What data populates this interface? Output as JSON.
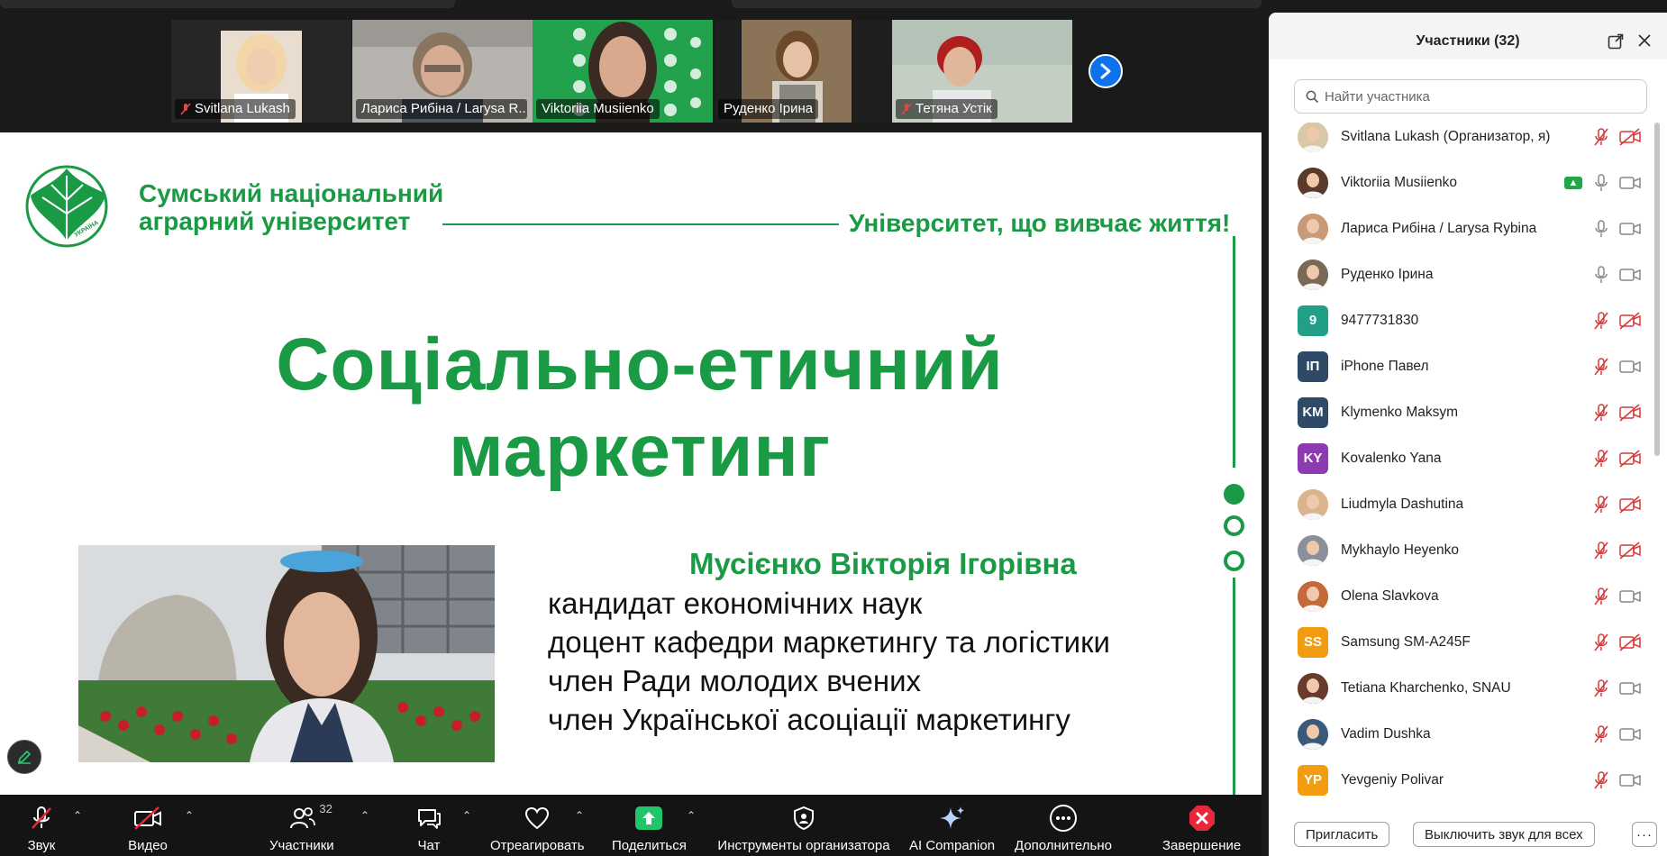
{
  "video_strip": {
    "tiles": [
      {
        "name": "Svitlana Lukash",
        "muted": true
      },
      {
        "name": "Лариса Рибіна / Larysa R...",
        "muted": false
      },
      {
        "name": "Viktoriia Musiienko",
        "muted": false,
        "active": true
      },
      {
        "name": "Руденко Ірина",
        "muted": false
      },
      {
        "name": "Тетяна Устік",
        "muted": true
      }
    ],
    "next_icon": "chevron-right-icon"
  },
  "slide": {
    "university_line1": "Сумський національний",
    "university_line2": "аграрний університет",
    "tagline": "Університет, що вивчає життя!",
    "logo_text": "УКРАЇНА",
    "title_line1": "Соціально-етичний",
    "title_line2": "маркетинг",
    "author": "Мусієнко Вікторія Ігорівна",
    "credentials": [
      "кандидат економічних наук",
      "доцент кафедри маркетингу та логістики",
      "член Ради молодих вчених",
      "член Української асоціації маркетингу"
    ],
    "brand_color": "#1a9a45"
  },
  "toolbar": {
    "audio": "Звук",
    "video": "Видео",
    "participants": "Участники",
    "participants_count": "32",
    "chat": "Чат",
    "react": "Отреагировать",
    "share": "Поделиться",
    "host_tools": "Инструменты организатора",
    "ai": "AI Companion",
    "more": "Дополнительно",
    "end": "Завершение"
  },
  "panel": {
    "title": "Участники (32)",
    "search_placeholder": "Найти участника",
    "participants": [
      {
        "name": "Svitlana Lukash (Организатор, я)",
        "avatar": "photo",
        "color": "#d8c8a8",
        "mic": "muted",
        "cam": "off"
      },
      {
        "name": "Viktoriia Musiienko",
        "avatar": "photo",
        "color": "#5a3a2a",
        "mic": "on",
        "cam": "on",
        "sharing": true
      },
      {
        "name": "Лариса Рибіна / Larysa Rybina",
        "avatar": "photo",
        "color": "#c89a78",
        "mic": "on",
        "cam": "on"
      },
      {
        "name": "Руденко Ірина",
        "avatar": "photo",
        "color": "#7a6a55",
        "mic": "on",
        "cam": "on"
      },
      {
        "name": "9477731830",
        "initials": "9",
        "color": "#21a087",
        "mic": "muted",
        "cam": "off"
      },
      {
        "name": "iPhone Павел",
        "initials": "ІП",
        "color": "#2e4a66",
        "mic": "muted",
        "cam": "on"
      },
      {
        "name": "Klymenko Maksym",
        "initials": "KM",
        "color": "#2e4a66",
        "mic": "muted",
        "cam": "off"
      },
      {
        "name": "Kovalenko Yana",
        "initials": "KY",
        "color": "#8e3bb3",
        "mic": "muted",
        "cam": "off"
      },
      {
        "name": "Liudmyla Dashutina",
        "avatar": "photo",
        "color": "#d9b48f",
        "mic": "muted",
        "cam": "off"
      },
      {
        "name": "Mykhaylo Heyenko",
        "avatar": "photo",
        "color": "#8a8f99",
        "mic": "muted",
        "cam": "off"
      },
      {
        "name": "Olena Slavkova",
        "avatar": "photo",
        "color": "#c46a3a",
        "mic": "muted",
        "cam": "on"
      },
      {
        "name": "Samsung SM-A245F",
        "initials": "SS",
        "color": "#f39c12",
        "mic": "muted",
        "cam": "off"
      },
      {
        "name": "Tetiana Kharchenko, SNAU",
        "avatar": "photo",
        "color": "#6a3a2a",
        "mic": "muted",
        "cam": "on"
      },
      {
        "name": "Vadim Dushka",
        "avatar": "photo",
        "color": "#3a5a7a",
        "mic": "muted",
        "cam": "on"
      },
      {
        "name": "Yevgeniy Polivar",
        "initials": "YP",
        "color": "#f39c12",
        "mic": "muted",
        "cam": "on"
      }
    ],
    "invite": "Пригласить",
    "mute_all": "Выключить звук для всех",
    "more": "···"
  }
}
